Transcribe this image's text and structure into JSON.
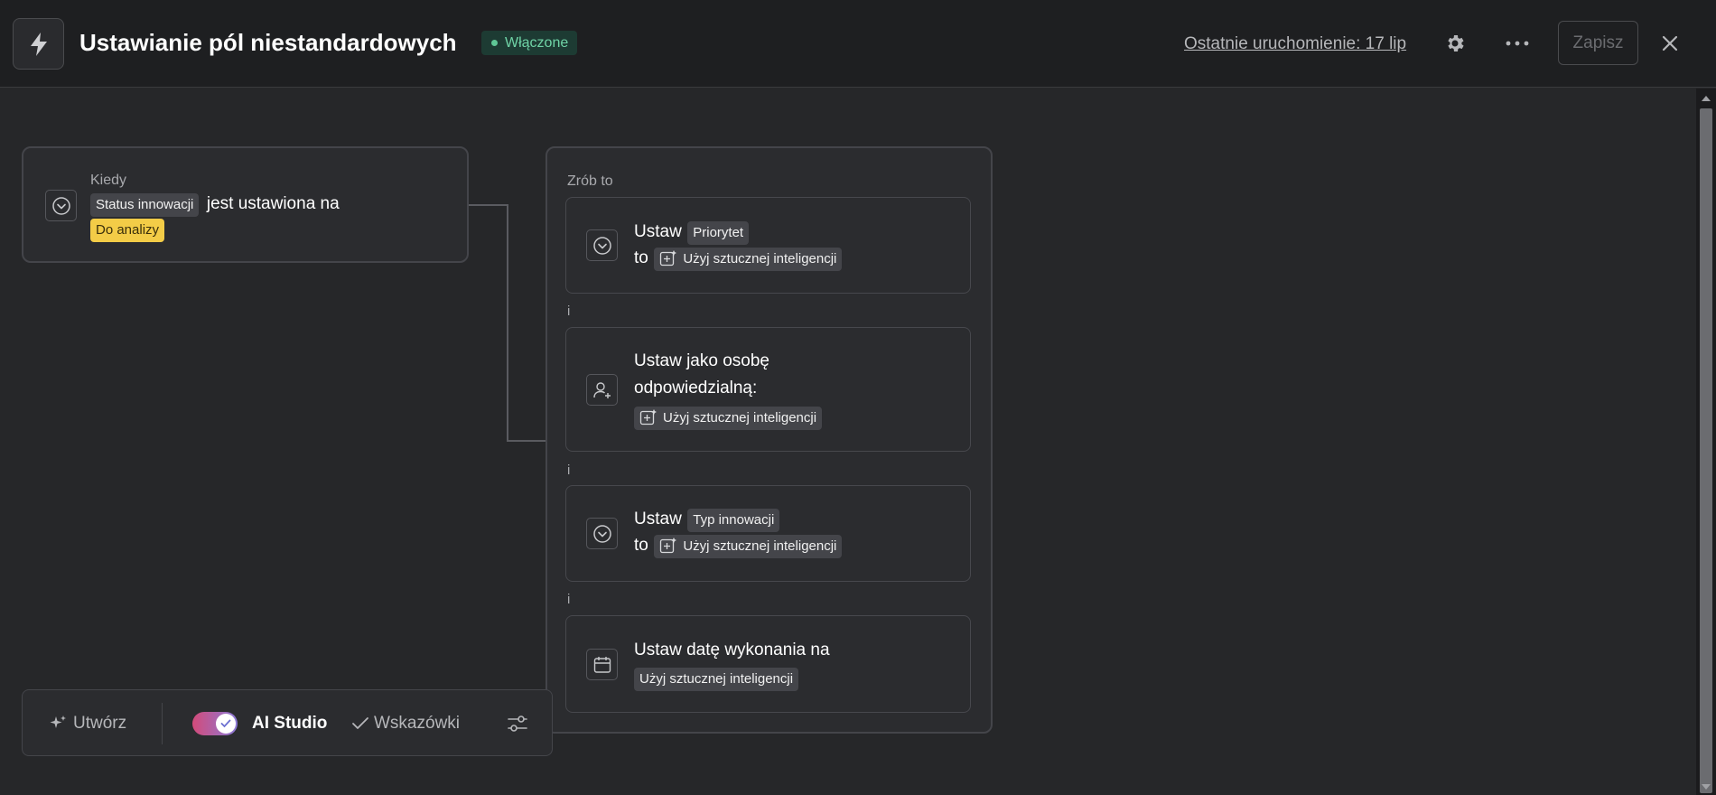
{
  "header": {
    "title": "Ustawianie pól niestandardowych",
    "status": "Włączone",
    "last_run": "Ostatnie uruchomienie: 17 lip",
    "save_label": "Zapisz"
  },
  "trigger": {
    "label": "Kiedy",
    "field_chip": "Status innowacji",
    "text": "jest ustawiona na",
    "value_chip": "Do analizy"
  },
  "actions": {
    "label": "Zrób to",
    "separator": "i",
    "ai_chip": "Użyj sztucznej inteligencji",
    "a1": {
      "verb": "Ustaw",
      "field": "Priorytet",
      "to": "to"
    },
    "a2": {
      "text_line1": "Ustaw jako osobę",
      "text_line2": "odpowiedzialną:"
    },
    "a3": {
      "verb": "Ustaw",
      "field": "Typ innowacji",
      "to": "to"
    },
    "a4": {
      "text": "Ustaw datę wykonania na"
    }
  },
  "toolbar": {
    "create_label": "Utwórz",
    "ai_studio_label": "AI Studio",
    "hints_label": "Wskazówki"
  },
  "colors": {
    "status_bg": "#1d3b33",
    "status_text": "#6fd3a6",
    "value_chip": "#f3cc47"
  }
}
